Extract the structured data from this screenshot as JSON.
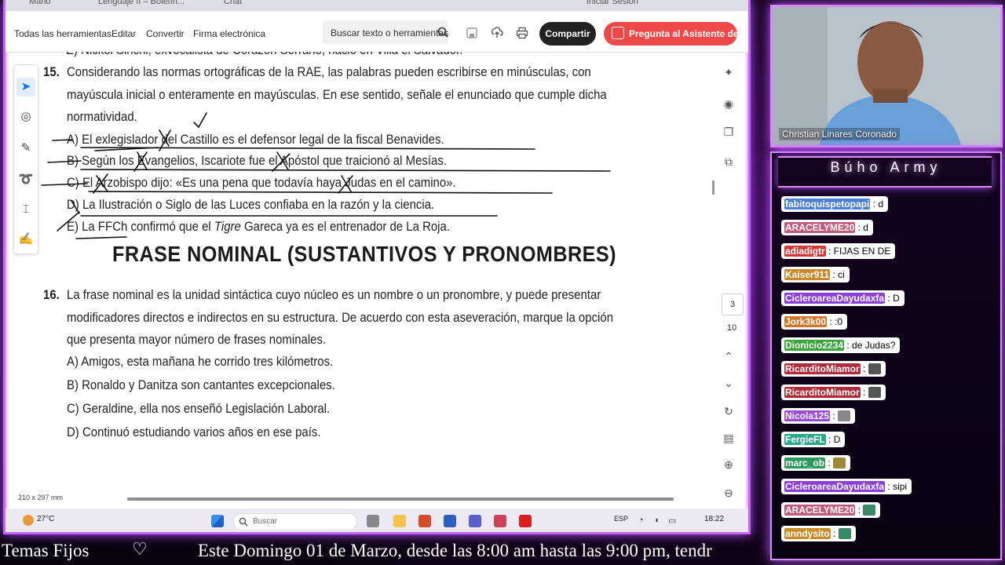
{
  "browser": {
    "tabs": [
      "Mario",
      "Lenguaje II – Boletín...",
      "Chat",
      "Iniciar Sesión"
    ]
  },
  "toolbar": {
    "menu": [
      "Todas las herramientas",
      "Editar",
      "Convertir",
      "Firma electrónica"
    ],
    "search_placeholder": "Buscar texto o herramientas",
    "share_label": "Compartir",
    "ai_label": "Pregunta al Asistente de IA"
  },
  "document": {
    "prev_line": "E) Nickol Sinchi, exvocalista de Corazón Serrano, nació en Villa el Salvador.",
    "q15": {
      "number": "15.",
      "stem": [
        "Considerando las normas ortográficas de la RAE, las palabras pueden escribirse en minúsculas, con",
        "mayúscula inicial o enteramente en mayúsculas. En ese sentido, señale el enunciado que cumple dicha",
        "normatividad."
      ],
      "options": [
        "A) El exlegislador del Castillo es el defensor legal de la fiscal Benavides.",
        "B) Según los Evangelios, Iscariote fue el Apóstol que traicionó al Mesías.",
        "C) El Arzobispo dijo: «Es una pena que todavía haya Judas en el camino».",
        "D) La Ilustración o Siglo de las Luces confiaba en la razón y la ciencia."
      ],
      "option_e_prefix": "E) La FFCh confirmó que el ",
      "option_e_italic": "Tigre",
      "option_e_suffix": " Gareca ya es el entrenador de La Roja."
    },
    "section_heading": "FRASE NOMINAL (SUSTANTIVOS Y PRONOMBRES)",
    "q16": {
      "number": "16.",
      "stem": [
        "La frase nominal es la unidad sintáctica cuyo núcleo es un nombre o un pronombre, y puede presentar",
        "modificadores directos e indirectos en su estructura. De acuerdo con esta aseveración, marque la opción",
        "que presenta mayor número de frases nominales."
      ],
      "options": [
        "A) Amigos, esta mañana he corrido tres kilómetros.",
        "B) Ronaldo y Danitza son cantantes excepcionales.",
        "C) Geraldine, ella nos enseñó Legislación Laboral.",
        "D) Continuó estudiando varios años en ese país."
      ]
    }
  },
  "viewer": {
    "page_current": "3",
    "page_total": "10",
    "page_size": "210 x 297 mm"
  },
  "taskbar": {
    "weather": "27°C",
    "search_placeholder": "Buscar",
    "lang": "ESP",
    "time": "18:22"
  },
  "webcam": {
    "name": "Christian Linares Coronado"
  },
  "chat": {
    "title": "Búho Army",
    "messages": [
      {
        "user": "fabitoquispetopapi",
        "text": ": d",
        "color": "#4a7fd6"
      },
      {
        "user": "ARACELYME20",
        "text": ": d",
        "color": "#c05a7a"
      },
      {
        "user": "adiadigtr",
        "text": ": FIJAS EN DE",
        "color": "#d23a3a"
      },
      {
        "user": "Kaiser911",
        "text": ": ci",
        "color": "#c98a2a"
      },
      {
        "user": "CicleroareaDayudaxfa",
        "text": ": D",
        "color": "#8a3fd6"
      },
      {
        "user": "Jork3k00",
        "text": ": :0",
        "color": "#d2762a"
      },
      {
        "user": "Dionicio2234",
        "text": ": de Judas?",
        "color": "#3aa63a"
      },
      {
        "user": "RicarditoMiamor",
        "text": ":",
        "color": "#b02a3a",
        "emote": "#555"
      },
      {
        "user": "RicarditoMiamor",
        "text": ":",
        "color": "#b02a3a",
        "emote": "#555"
      },
      {
        "user": "Nicola125",
        "text": ":",
        "color": "#9a4ad6",
        "emote": "#888"
      },
      {
        "user": "FergieFL",
        "text": ": D",
        "color": "#2aa68a"
      },
      {
        "user": "marc_ob",
        "text": ":",
        "color": "#2a9a5a",
        "emote": "#9a8a3a"
      },
      {
        "user": "CicleroareaDayudaxfa",
        "text": ": sipi",
        "color": "#8a3fd6"
      },
      {
        "user": "ARACELYME20",
        "text": ":",
        "color": "#c05a7a",
        "emote": "#3a8a6a"
      },
      {
        "user": "anndysito",
        "text": ":",
        "color": "#c98a2a",
        "emote": "#3a8a6a"
      }
    ]
  },
  "ticker": {
    "left": "Temas Fijos",
    "heart": "♡",
    "text": "Este Domingo 01 de Marzo, desde las 8:00 am hasta las 9:00 pm, tendr"
  }
}
